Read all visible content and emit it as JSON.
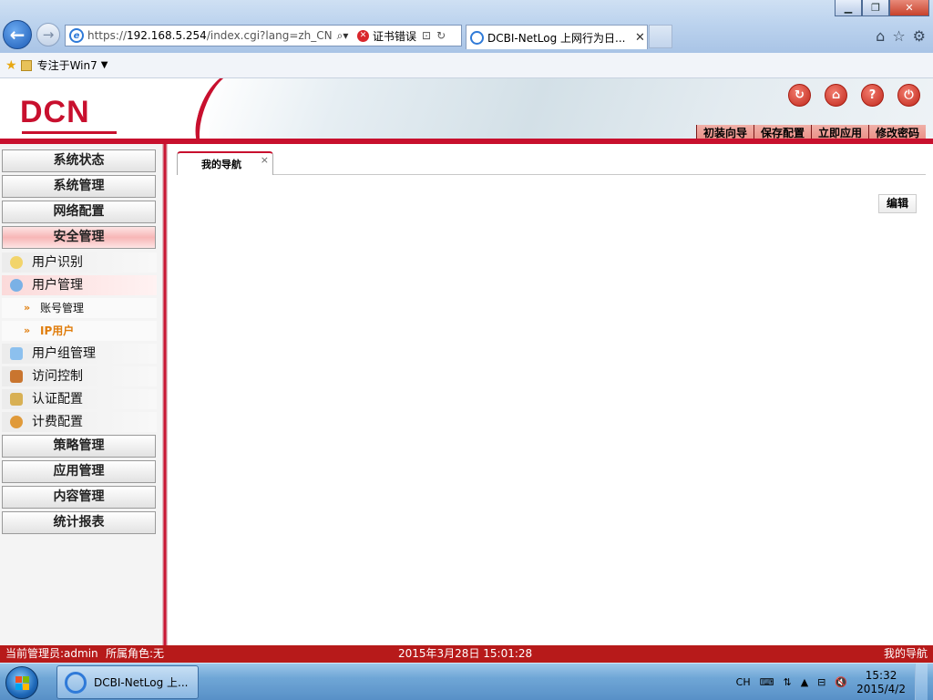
{
  "browser": {
    "url_prefix": "https://",
    "url_host": "192.168.5.254",
    "url_path": "/index.cgi?lang=zh_CN.U",
    "cert_error": "证书错误",
    "tab_title": "DCBI-NetLog 上网行为日...",
    "tab_close": "✕",
    "favorites_item": "专注于Win7"
  },
  "header": {
    "logo": "DCN",
    "icons": [
      "refresh-icon",
      "home-icon",
      "help-icon",
      "logout-icon"
    ],
    "menu": [
      "初装向导",
      "保存配置",
      "立即应用",
      "修改密码"
    ]
  },
  "sidebar": {
    "categories_top": [
      "系统状态",
      "系统管理",
      "网络配置",
      "安全管理"
    ],
    "security_items": [
      {
        "label": "用户识别",
        "icon": "user-identify-icon"
      },
      {
        "label": "用户管理",
        "icon": "user-manage-icon"
      }
    ],
    "user_manage_leaves": [
      "账号管理",
      "IP用户"
    ],
    "security_items_2": [
      {
        "label": "用户组管理",
        "icon": "user-group-icon"
      },
      {
        "label": "访问控制",
        "icon": "access-control-icon"
      },
      {
        "label": "认证配置",
        "icon": "auth-config-icon"
      },
      {
        "label": "计费配置",
        "icon": "billing-config-icon"
      }
    ],
    "categories_bottom": [
      "策略管理",
      "应用管理",
      "内容管理",
      "统计报表"
    ]
  },
  "main": {
    "tab_label": "我的导航",
    "tab_close": "×",
    "edit_button": "编辑"
  },
  "status_bar": {
    "admin": "当前管理员:admin",
    "role": "所属角色:无",
    "datetime": "2015年3月28日 15:01:28",
    "right": "我的导航"
  },
  "taskbar": {
    "ie_task": "DCBI-NetLog 上...",
    "lang": "CH",
    "time": "15:32",
    "date": "2015/4/2"
  }
}
